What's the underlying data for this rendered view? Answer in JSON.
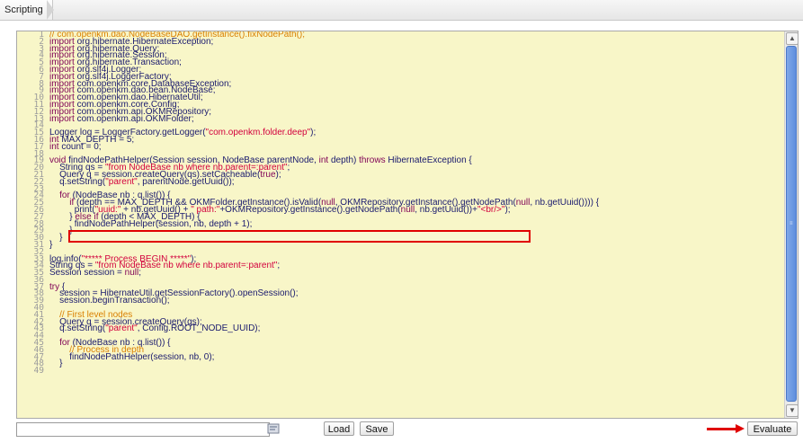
{
  "tab": {
    "label": "Scripting"
  },
  "editor": {
    "line_numbers": [
      "1",
      "2",
      "3",
      "4",
      "5",
      "6",
      "7",
      "8",
      "9",
      "10",
      "11",
      "12",
      "13",
      "14",
      "15",
      "16",
      "17",
      "18",
      "19",
      "20",
      "21",
      "22",
      "23",
      "24",
      "25",
      "26",
      "27",
      "28",
      "29",
      "30",
      "31",
      "32",
      "33",
      "34",
      "35",
      "36",
      "37",
      "38",
      "39",
      "40",
      "41",
      "42",
      "43",
      "44",
      "45",
      "46",
      "47",
      "48",
      "49"
    ],
    "lines": [
      "// com.openkm.dao.NodeBaseDAO.getInstance().fixNodePath();",
      "import org.hibernate.HibernateException;",
      "import org.hibernate.Query;",
      "import org.hibernate.Session;",
      "import org.hibernate.Transaction;",
      "import org.slf4j.Logger;",
      "import org.slf4j.LoggerFactory;",
      "import com.openkm.core.DatabaseException;",
      "import com.openkm.dao.bean.NodeBase;",
      "import com.openkm.dao.HibernateUtil;",
      "import com.openkm.core.Config;",
      "import com.openkm.api.OKMRepository;",
      "import com.openkm.api.OKMFolder;",
      "",
      "Logger log = LoggerFactory.getLogger(\"com.openkm.folder.deep\");",
      "int MAX_DEPTH = 5;",
      "int count = 0;",
      "",
      "void findNodePathHelper(Session session, NodeBase parentNode, int depth) throws HibernateException {",
      "    String qs = \"from NodeBase nb where nb.parent=:parent\";",
      "    Query q = session.createQuery(qs).setCacheable(true);",
      "    q.setString(\"parent\", parentNode.getUuid());",
      "",
      "    for (NodeBase nb : q.list()) {",
      "        if (depth == MAX_DEPTH && OKMFolder.getInstance().isValid(null, OKMRepository.getInstance().getNodePath(null, nb.getUuid()))) {",
      "          print(\"uuid:\" + nb.getUuid() + \" path:\"+OKMRepository.getInstance().getNodePath(null, nb.getUuid())+\"<br/>\");",
      "        } else if (depth < MAX_DEPTH) {",
      "          findNodePathHelper(session, nb, depth + 1);",
      "        }",
      "    }",
      "}",
      "",
      "log.info(\"***** Process BEGIN *****\");",
      "String qs = \"from NodeBase nb where nb.parent=:parent\";",
      "Session session = null;",
      "",
      "try {",
      "    session = HibernateUtil.getSessionFactory().openSession();",
      "    session.beginTransaction();",
      "",
      "    // First level nodes",
      "    Query q = session.createQuery(qs);",
      "    q.setString(\"parent\", Config.ROOT_NODE_UUID);",
      "",
      "    for (NodeBase nb : q.list()) {",
      "        // Process in depth",
      "        findNodePathHelper(session, nb, 0);",
      "    }",
      ""
    ]
  },
  "toolbar": {
    "path_value": "",
    "load_label": "Load",
    "save_label": "Save",
    "evaluate_label": "Evaluate"
  },
  "colors": {
    "editor_bg": "#f8f6c8",
    "highlight": "#e00000",
    "scroll_thumb": "#6d98e3"
  }
}
